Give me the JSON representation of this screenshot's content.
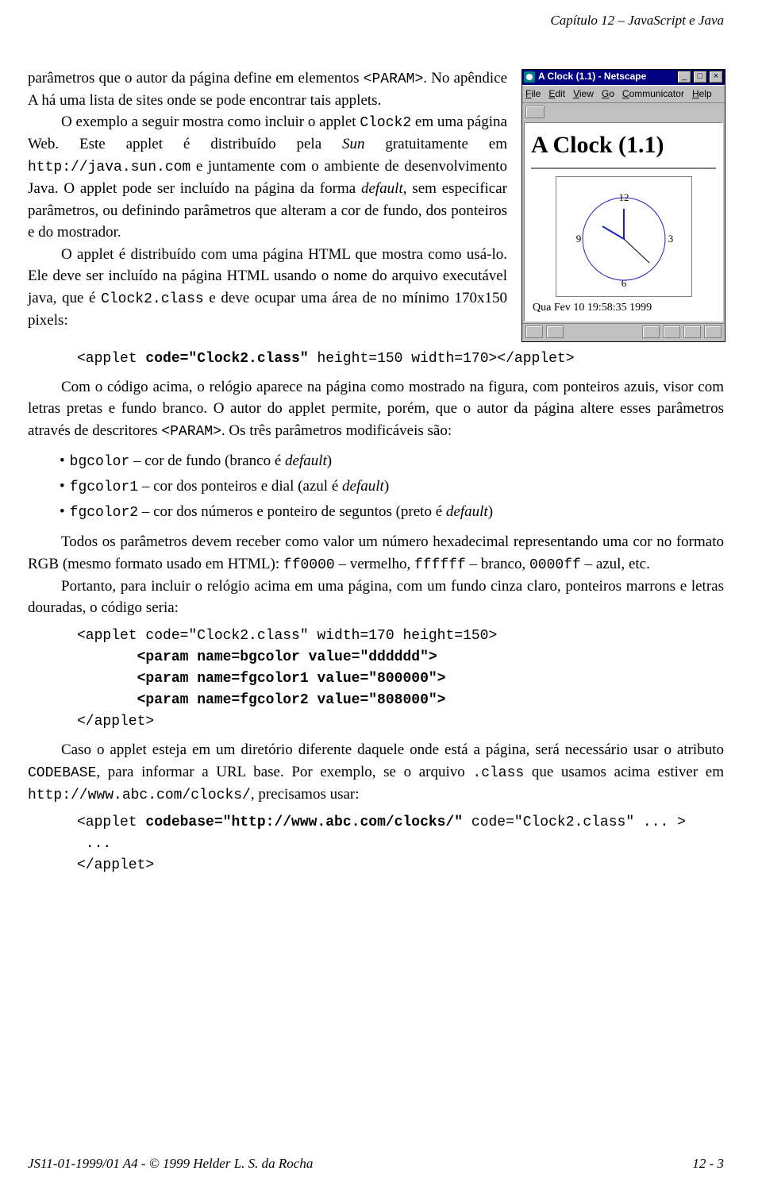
{
  "chapter_header": "Capítulo 12 – JavaScript e Java",
  "fig": {
    "titlebar": "A Clock (1.1) - Netscape",
    "menus": [
      "File",
      "Edit",
      "View",
      "Go",
      "Communicator",
      "Help"
    ],
    "doc_title": "A Clock (1.1)",
    "clock_numbers": {
      "top": "12",
      "right": "3",
      "bottom": "6",
      "left": "9"
    },
    "status_text": "Qua Fev 10 19:58:35 1999"
  },
  "p1a": "parâmetros que o autor da página define em elementos ",
  "p1_code1": "<PARAM>",
  "p1b": ". No apêndice A há uma lista de sites onde se pode encontrar tais applets.",
  "p2a": "O exemplo a seguir mostra como incluir o applet ",
  "p2_code1": "Clock2",
  "p2b": " em uma página Web. Este applet é distribuído pela ",
  "p2_ital1": "Sun",
  "p2c": " gratuitamente em ",
  "p2_code2": "http://java.sun.com",
  "p2d": " e juntamente com o ambiente de desenvolvimento Java. O applet pode ser incluído na página da forma ",
  "p2_ital2": "default",
  "p2e": ", sem especificar parâmetros, ou definindo parâmetros que alteram a cor de fundo, dos ponteiros e do mostrador.",
  "p3a": "O applet é distribuído com uma página HTML que mostra como usá-lo. Ele deve ser incluído na página HTML usando o nome do arquivo executável java, que é ",
  "p3_code1": "Clock2.class",
  "p3b": " e deve ocupar uma área de no mínimo 170x150 pixels:",
  "code1_a": "<applet ",
  "code1_b": "code=\"Clock2.class\"",
  "code1_c": " height=150 width=170></applet>",
  "p4a": "Com o código acima, o relógio aparece na página como mostrado na figura, com ponteiros azuis, visor com letras pretas e fundo branco. O autor do applet permite, porém, que o autor da página altere esses parâmetros através de descritores ",
  "p4_code1": "<PARAM>",
  "p4b": ". Os três parâmetros modificáveis são:",
  "li1_code": "bgcolor",
  "li1_a": " – cor de fundo (branco é ",
  "li1_ital": "default",
  "li1_b": ")",
  "li2_code": "fgcolor1",
  "li2_a": " – cor dos ponteiros e dial (azul é ",
  "li2_ital": "default",
  "li2_b": ")",
  "li3_code": "fgcolor2",
  "li3_a": " – cor dos números e ponteiro de seguntos (preto é ",
  "li3_ital": "default",
  "li3_b": ")",
  "p5a": "Todos os parâmetros devem receber como valor um número hexadecimal representando uma cor no formato RGB (mesmo formato usado em HTML): ",
  "p5_code1": "ff0000",
  "p5b": " – vermelho, ",
  "p5_code2": "ffffff",
  "p5c": " – branco, ",
  "p5_code3": "0000ff",
  "p5d": " – azul, etc.",
  "p6": "Portanto, para incluir o relógio acima em uma página, com um fundo cinza claro, ponteiros marrons e letras douradas, o código seria:",
  "code2_l1": "<applet code=\"Clock2.class\" width=170 height=150>",
  "code2_l2": "       <param name=bgcolor value=\"dddddd\">",
  "code2_l3": "       <param name=fgcolor1 value=\"800000\">",
  "code2_l4": "       <param name=fgcolor2 value=\"808000\">",
  "code2_l5": "</applet>",
  "p7a": "Caso o applet esteja em um diretório diferente daquele onde está a página, será necessário usar o atributo ",
  "p7_code1": "CODEBASE",
  "p7b": ", para informar a URL base. Por exemplo, se o arquivo ",
  "p7_code2": ".class",
  "p7c": " que usamos acima estiver em ",
  "p7_code3": "http://www.abc.com/clocks/",
  "p7d": ", precisamos usar:",
  "code3_l1a": "<applet ",
  "code3_l1b": "codebase=\"http://www.abc.com/clocks/\"",
  "code3_l1c": " code=\"Clock2.class\" ... >",
  "code3_l2": " ...",
  "code3_l3": "</applet>",
  "footer_left": "JS11-01-1999/01 A4 - © 1999 Helder L. S. da Rocha",
  "footer_right": "12 - 3"
}
